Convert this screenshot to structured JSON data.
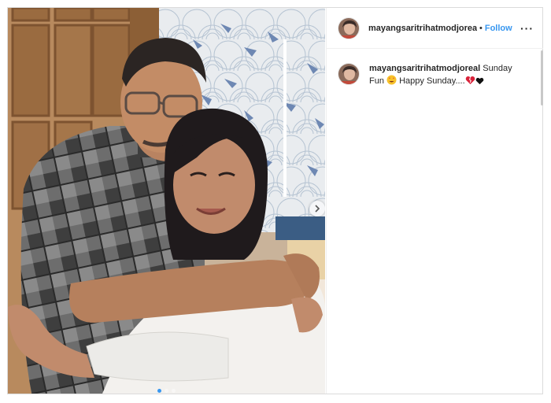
{
  "post": {
    "username": "mayangsaritrihatmodjoreal",
    "separator": "•",
    "follow_label": "Follow",
    "more_label": "···",
    "caption_user": "mayangsaritrihatmodjoreal",
    "caption_text": "Sunday Fun",
    "caption_text2": "Happy Sunday....",
    "carousel": {
      "total": 3,
      "active_index": 0
    }
  },
  "icons": {
    "more": "more-options-icon",
    "next": "carousel-next-icon",
    "emoji_star": "star-struck-emoji",
    "emoji_heart_broken": "broken-heart-emoji",
    "emoji_heart_black": "black-heart-emoji"
  },
  "colors": {
    "link_blue": "#3897f0",
    "text": "#262626",
    "border": "#dbdbdb"
  }
}
